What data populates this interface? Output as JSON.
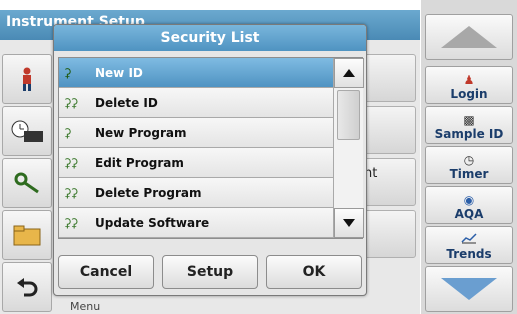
{
  "background": {
    "title": "Instrument Setup",
    "partial_label": "nt",
    "menu_label": "Menu"
  },
  "right_panel": {
    "buttons": [
      {
        "label": "Login",
        "icon": "person-icon"
      },
      {
        "label": "Sample ID",
        "icon": "sample-icon"
      },
      {
        "label": "Timer",
        "icon": "timer-icon"
      },
      {
        "label": "AQA",
        "icon": "aqa-icon"
      },
      {
        "label": "Trends",
        "icon": "trends-icon"
      }
    ]
  },
  "dialog": {
    "title": "Security List",
    "items": [
      {
        "label": "New ID",
        "keys": 1,
        "selected": true
      },
      {
        "label": "Delete ID",
        "keys": 2,
        "selected": false
      },
      {
        "label": "New Program",
        "keys": 1,
        "selected": false
      },
      {
        "label": "Edit Program",
        "keys": 2,
        "selected": false
      },
      {
        "label": "Delete Program",
        "keys": 2,
        "selected": false
      },
      {
        "label": "Update Software",
        "keys": 2,
        "selected": false
      }
    ],
    "buttons": {
      "cancel": "Cancel",
      "setup": "Setup",
      "ok": "OK"
    }
  },
  "colors": {
    "title_bar": "#4f93c1",
    "selected_row": "#5a9fcb"
  }
}
